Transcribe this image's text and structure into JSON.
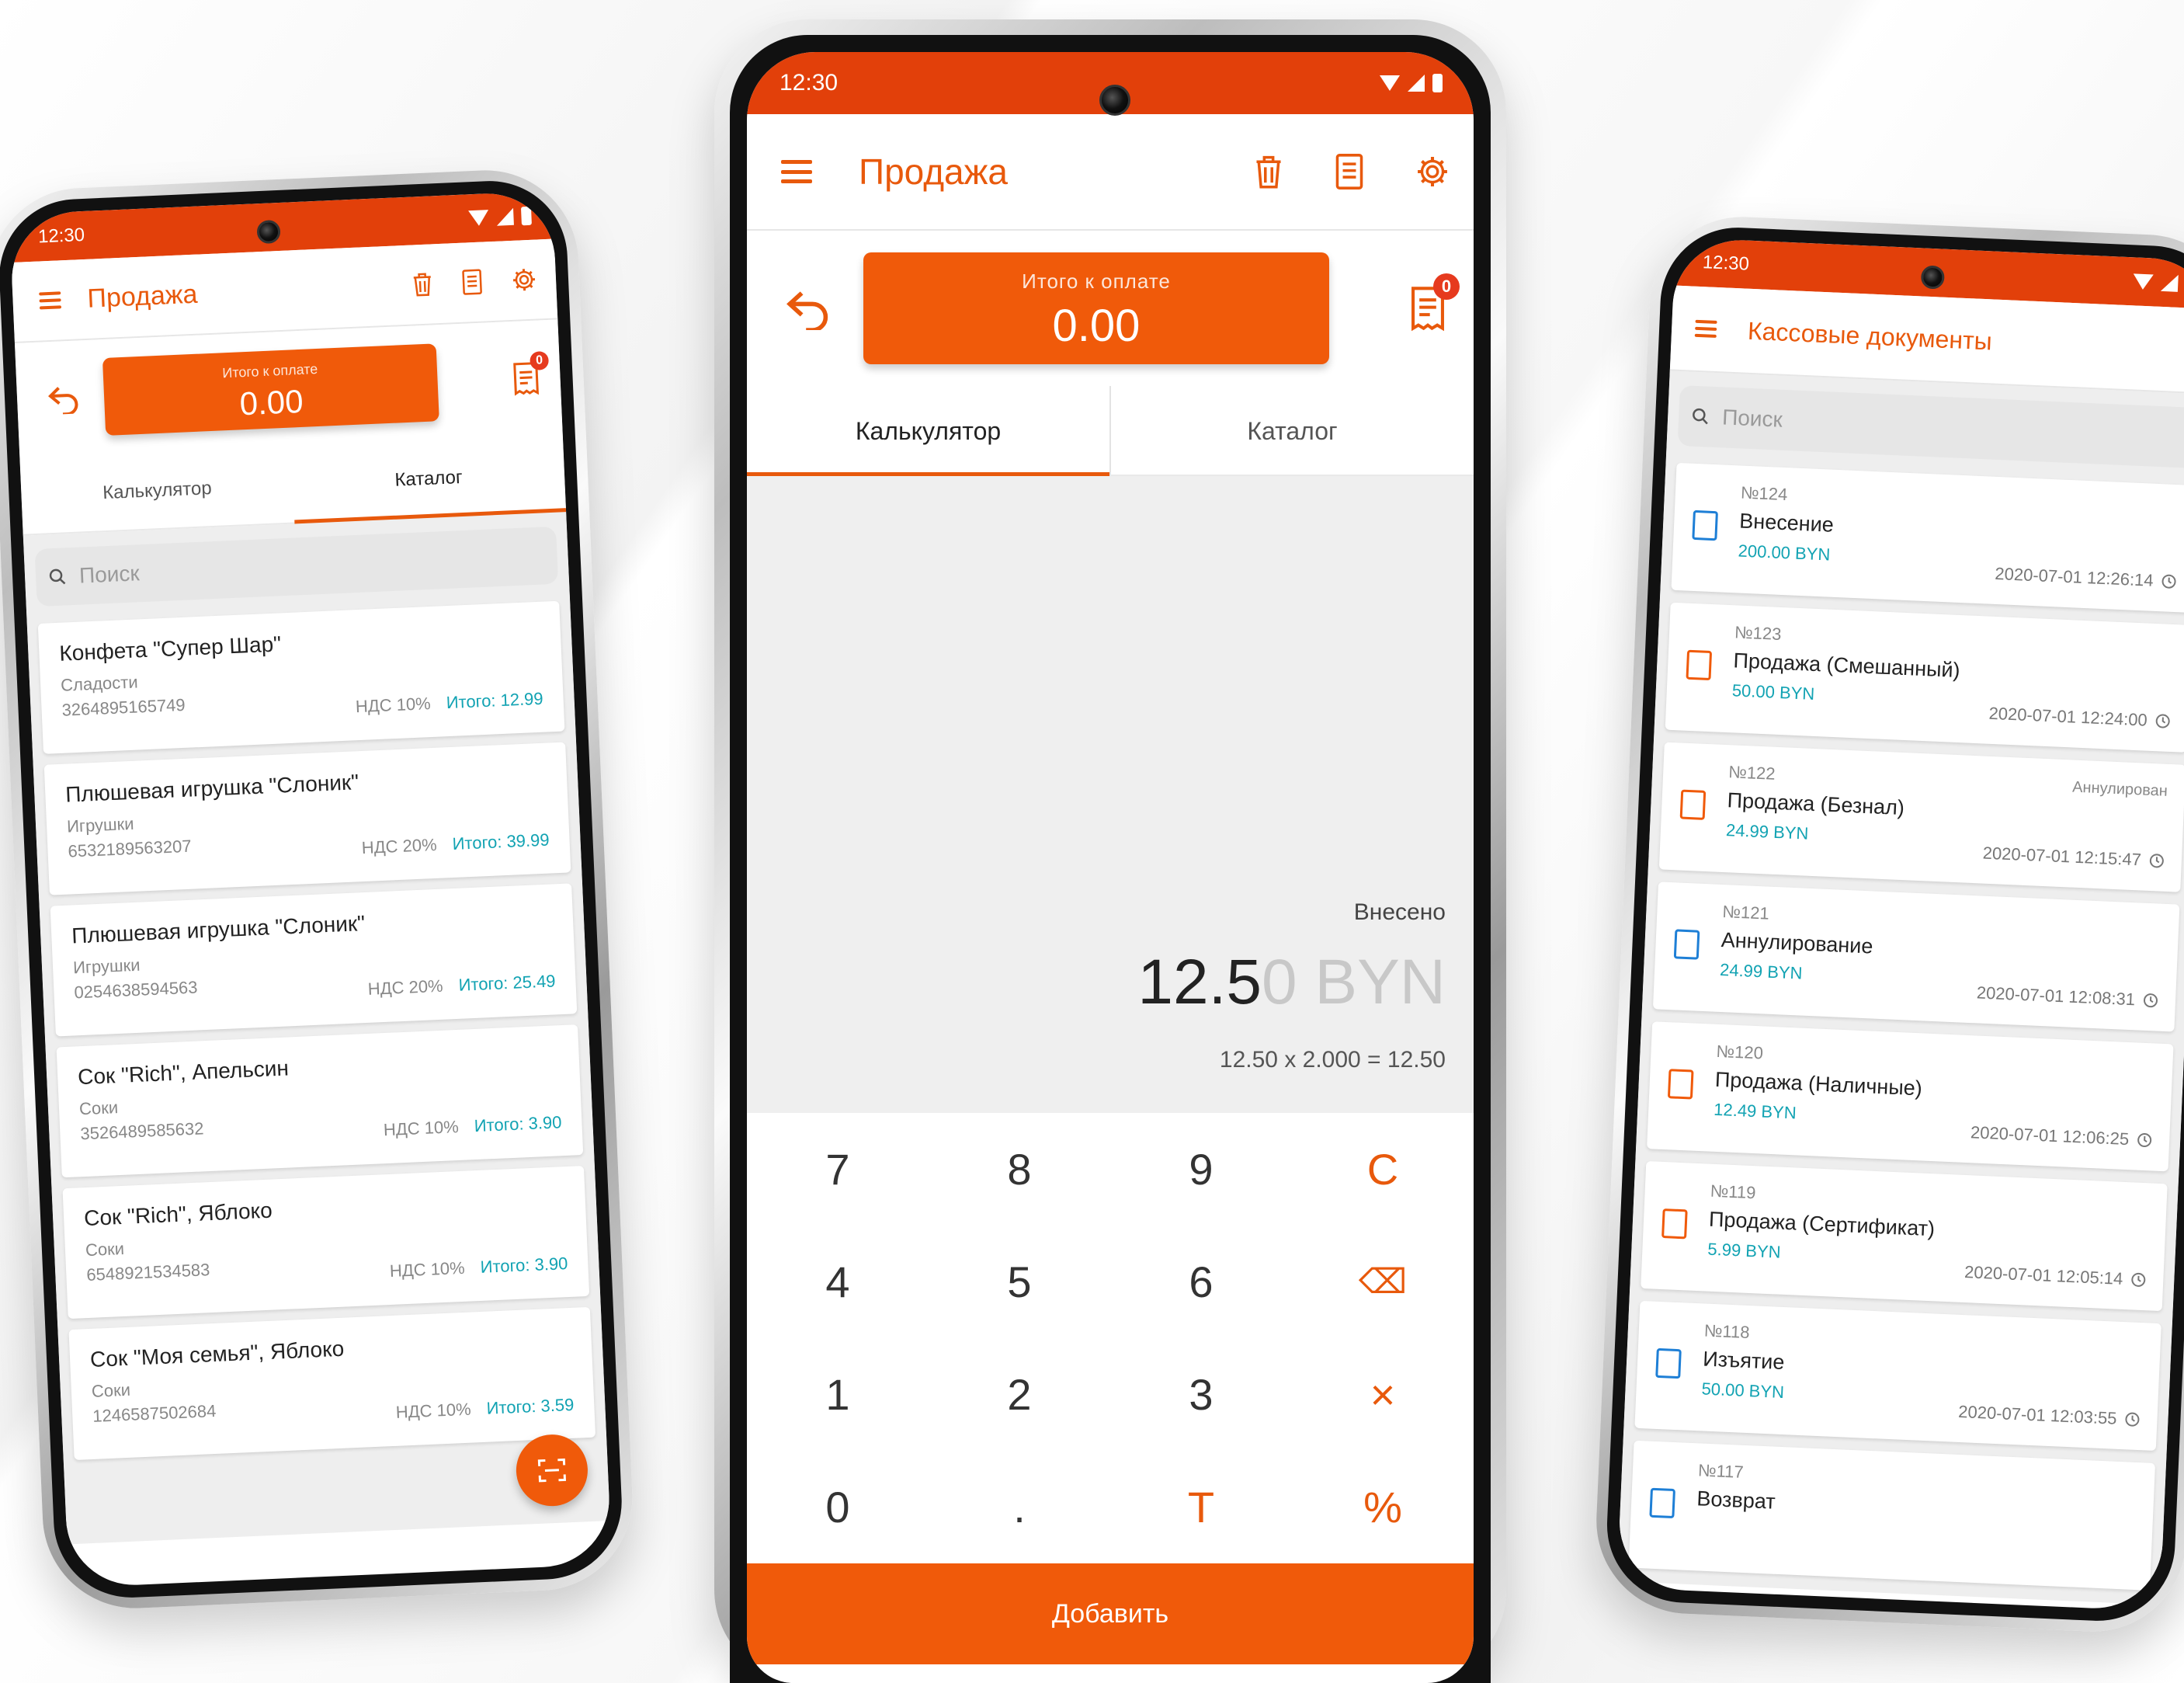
{
  "colors": {
    "accent": "#f05a0a",
    "status_bar": "#e2400a",
    "teal": "#13a3b3",
    "blue_icon": "#1e7fd6"
  },
  "status": {
    "time": "12:30"
  },
  "left": {
    "title": "Продажа",
    "total_label": "Итого к оплате",
    "total_value": "0.00",
    "badge": "0",
    "tabs": [
      "Калькулятор",
      "Каталог"
    ],
    "search_placeholder": "Поиск",
    "products": [
      {
        "name": "Конфета \"Супер Шар\"",
        "category": "Сладости",
        "code": "3264895165749",
        "vat": "НДС 10%",
        "total": "Итого: 12.99"
      },
      {
        "name": "Плюшевая игрушка \"Слоник\"",
        "category": "Игрушки",
        "code": "6532189563207",
        "vat": "НДС 20%",
        "total": "Итого: 39.99"
      },
      {
        "name": "Плюшевая игрушка \"Слоник\"",
        "category": "Игрушки",
        "code": "0254638594563",
        "vat": "НДС 20%",
        "total": "Итого: 25.49"
      },
      {
        "name": "Сок \"Rich\", Апельсин",
        "category": "Соки",
        "code": "3526489585632",
        "vat": "НДС 10%",
        "total": "Итого: 3.90"
      },
      {
        "name": "Сок \"Rich\", Яблоко",
        "category": "Соки",
        "code": "6548921534583",
        "vat": "НДС 10%",
        "total": "Итого: 3.90"
      },
      {
        "name": "Сок \"Моя семья\", Яблоко",
        "category": "Соки",
        "code": "1246587502684",
        "vat": "НДС 10%",
        "total": "Итого: 3.59"
      }
    ]
  },
  "center": {
    "title": "Продажа",
    "total_label": "Итого к оплате",
    "total_value": "0.00",
    "badge": "0",
    "tabs": [
      "Калькулятор",
      "Каталог"
    ],
    "entered_label": "Внесено",
    "amount_typed": "12.5",
    "amount_hint": "0 BYN",
    "formula": "12.50 x 2.000 = 12.50",
    "keys": [
      "7",
      "8",
      "9",
      "C",
      "4",
      "5",
      "6",
      "⌫",
      "1",
      "2",
      "3",
      "×",
      "0",
      ".",
      "T",
      "%"
    ],
    "add_button": "Добавить"
  },
  "right": {
    "title": "Кассовые документы",
    "search_placeholder": "Поиск",
    "documents": [
      {
        "number": "№124",
        "type": "Внесение",
        "amount": "200.00 BYN",
        "datetime": "2020-07-01 12:26:14",
        "status": "",
        "icon": "deposit-icon",
        "icon_color": "blue"
      },
      {
        "number": "№123",
        "type": "Продажа (Смешанный)",
        "amount": "50.00 BYN",
        "datetime": "2020-07-01 12:24:00",
        "status": "",
        "icon": "mixed-payment-icon",
        "icon_color": "orange"
      },
      {
        "number": "№122",
        "type": "Продажа (Безнал)",
        "amount": "24.99 BYN",
        "datetime": "2020-07-01 12:15:47",
        "status": "Аннулирован",
        "icon": "card-payment-icon",
        "icon_color": "orange"
      },
      {
        "number": "№121",
        "type": "Аннулирование",
        "amount": "24.99 BYN",
        "datetime": "2020-07-01 12:08:31",
        "status": "",
        "icon": "cancel-doc-icon",
        "icon_color": "blue"
      },
      {
        "number": "№120",
        "type": "Продажа (Наличные)",
        "amount": "12.49 BYN",
        "datetime": "2020-07-01 12:06:25",
        "status": "",
        "icon": "cash-payment-icon",
        "icon_color": "orange"
      },
      {
        "number": "№119",
        "type": "Продажа (Сертификат)",
        "amount": "5.99 BYN",
        "datetime": "2020-07-01 12:05:14",
        "status": "",
        "icon": "certificate-payment-icon",
        "icon_color": "orange"
      },
      {
        "number": "№118",
        "type": "Изъятие",
        "amount": "50.00 BYN",
        "datetime": "2020-07-01 12:03:55",
        "status": "",
        "icon": "withdraw-icon",
        "icon_color": "blue"
      },
      {
        "number": "№117",
        "type": "Возврат",
        "amount": "",
        "datetime": "",
        "status": "",
        "icon": "refund-icon",
        "icon_color": "blue"
      }
    ]
  }
}
